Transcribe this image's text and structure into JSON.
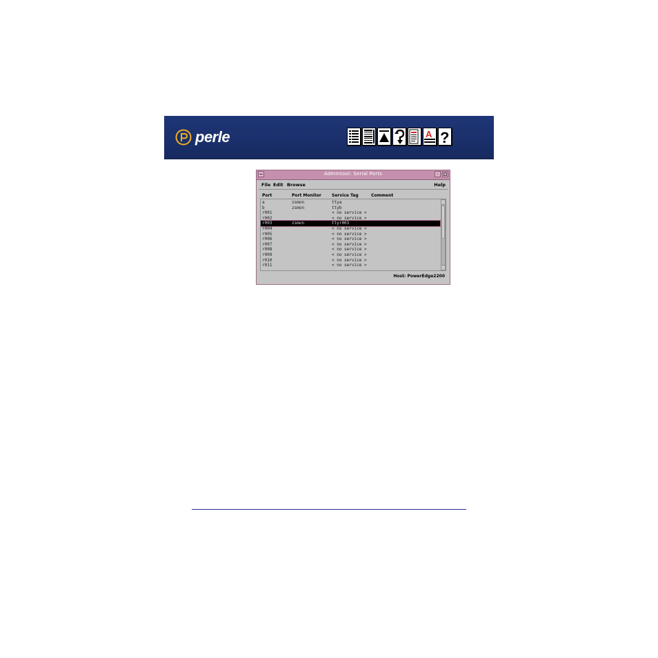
{
  "banner": {
    "brand": "perle",
    "colors": {
      "background": "#1a2f6a",
      "logo_accent": "#f0b020"
    },
    "nav_icons": [
      {
        "name": "contents-icon"
      },
      {
        "name": "index-icon"
      },
      {
        "name": "top-icon"
      },
      {
        "name": "back-icon"
      },
      {
        "name": "document-icon"
      },
      {
        "name": "font-icon"
      },
      {
        "name": "help-icon"
      }
    ]
  },
  "window": {
    "title": "Admintool: Serial Ports",
    "menu": {
      "file": "File",
      "edit": "Edit",
      "browse": "Browse",
      "help": "Help"
    },
    "columns": {
      "port": "Port",
      "port_monitor": "Port Monitor",
      "service_tag": "Service Tag",
      "comment": "Comment"
    },
    "rows": [
      {
        "port": "a",
        "monitor": "zsmon",
        "tag": "ttya",
        "comment": ""
      },
      {
        "port": "b",
        "monitor": "zsmon",
        "tag": "ttyb",
        "comment": ""
      },
      {
        "port": "r001",
        "monitor": "",
        "tag": "< no service >",
        "comment": ""
      },
      {
        "port": "r002",
        "monitor": "",
        "tag": "< no service >",
        "comment": ""
      },
      {
        "port": "r003",
        "monitor": "zsmon",
        "tag": "ttyr003",
        "comment": "",
        "selected": true
      },
      {
        "port": "r004",
        "monitor": "",
        "tag": "< no service >",
        "comment": ""
      },
      {
        "port": "r005",
        "monitor": "",
        "tag": "< no service >",
        "comment": ""
      },
      {
        "port": "r006",
        "monitor": "",
        "tag": "< no service >",
        "comment": ""
      },
      {
        "port": "r007",
        "monitor": "",
        "tag": "< no service >",
        "comment": ""
      },
      {
        "port": "r008",
        "monitor": "",
        "tag": "< no service >",
        "comment": ""
      },
      {
        "port": "r009",
        "monitor": "",
        "tag": "< no service >",
        "comment": ""
      },
      {
        "port": "r010",
        "monitor": "",
        "tag": "< no service >",
        "comment": ""
      },
      {
        "port": "r011",
        "monitor": "",
        "tag": "< no service >",
        "comment": ""
      }
    ],
    "host": "Host: PowerEdge2200",
    "colors": {
      "titlebar": "#c490ad",
      "body": "#c4c4c4",
      "selection": "#000000"
    }
  }
}
